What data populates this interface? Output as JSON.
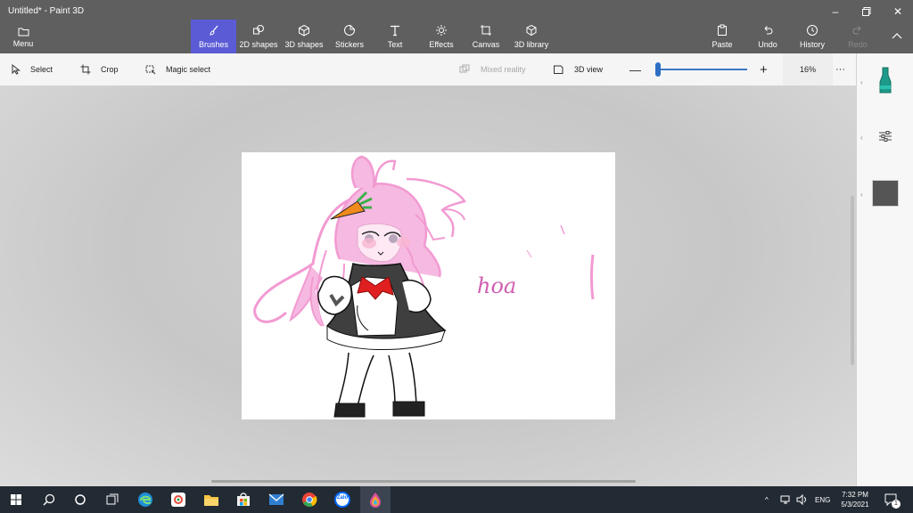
{
  "window": {
    "title": "Untitled* - Paint 3D",
    "controls": [
      "minimize-icon",
      "maximize-icon",
      "close-icon"
    ]
  },
  "menu": {
    "label": "Menu",
    "icon": "folder-icon"
  },
  "ribbon": {
    "tools": [
      {
        "label": "Brushes",
        "icon": "brush-icon",
        "active": true
      },
      {
        "label": "2D shapes",
        "icon": "shapes-2d-icon"
      },
      {
        "label": "3D shapes",
        "icon": "cube-icon"
      },
      {
        "label": "Stickers",
        "icon": "sticker-icon"
      },
      {
        "label": "Text",
        "icon": "text-icon"
      },
      {
        "label": "Effects",
        "icon": "sun-icon"
      },
      {
        "label": "Canvas",
        "icon": "canvas-icon"
      },
      {
        "label": "3D library",
        "icon": "library-icon"
      }
    ],
    "actions": [
      {
        "label": "Paste",
        "icon": "paste-icon"
      },
      {
        "label": "Undo",
        "icon": "undo-icon"
      },
      {
        "label": "History",
        "icon": "history-icon"
      },
      {
        "label": "Redo",
        "icon": "redo-icon",
        "disabled": true
      }
    ]
  },
  "toolbar": {
    "select": "Select",
    "crop": "Crop",
    "magic_select": "Magic select",
    "mixed_reality": "Mixed reality",
    "view_3d": "3D view",
    "zoom_percent": "16%",
    "zoom_level": 0.16,
    "more": "···"
  },
  "canvas": {
    "handwriting": "hoa"
  },
  "side_panel": {
    "icons": [
      "marker-icon",
      "adjust-icon",
      "color-swatch"
    ],
    "active_color": "#555555"
  },
  "taskbar": {
    "icons": [
      "windows-start-icon",
      "search-icon",
      "cortana-icon",
      "task-view-icon",
      "edge-icon",
      "photos-icon",
      "file-explorer-icon",
      "store-icon",
      "mail-icon",
      "chrome-icon",
      "zalo-icon",
      "paint3d-icon"
    ],
    "zalo_label": "Zalo",
    "language": "ENG",
    "time": "7:32 PM",
    "date": "5/3/2021",
    "notification_count": "1"
  },
  "colors": {
    "titlebar": "#5f5f5f",
    "accent": "#5b5bd6",
    "hair_pink": "#f29ad2",
    "bow_red": "#e02020",
    "carrot_orange": "#f08a1c",
    "leaf_green": "#3cb04a"
  }
}
